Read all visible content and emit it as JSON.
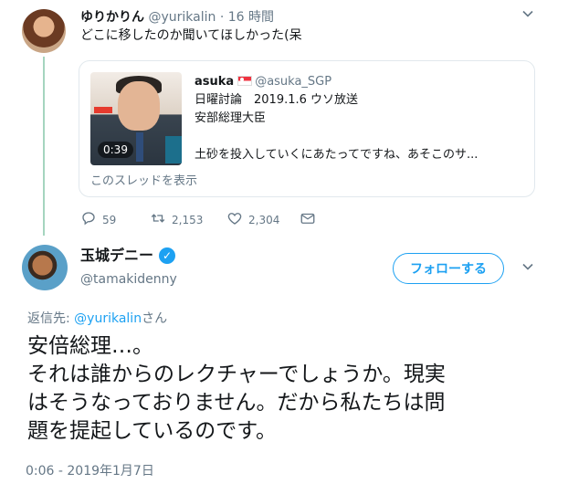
{
  "reply_tweet": {
    "name": "ゆりかりん",
    "handle": "@yurikalin",
    "separator": "·",
    "time": "16 時間",
    "text": "どこに移したのか聞いてほしかった(呆",
    "quoted": {
      "name": "asuka",
      "handle": "@asuka_SGP",
      "lines": [
        "日曜討論　2019.1.6 ウソ放送",
        "安部総理大臣",
        "土砂を投入していくにあたってですね、あそこのサ..."
      ],
      "video_duration": "0:39",
      "show_thread": "このスレッドを表示"
    },
    "actions": {
      "replies": "59",
      "retweets": "2,153",
      "likes": "2,304"
    }
  },
  "main_tweet": {
    "name": "玉城デニー",
    "handle": "@tamakidenny",
    "follow_label": "フォローする",
    "reply_prefix": "返信先: ",
    "reply_mention": "@yurikalin",
    "reply_suffix": "さん",
    "text": "安倍総理…。\nそれは誰からのレクチャーでしょうか。現実\nはそうなっておりません。だから私たちは問\n題を提起しているのです。",
    "timestamp": "0:06 - 2019年1月7日"
  },
  "colors": {
    "accent": "#1da1f2",
    "thread_line": "#a5d5bf",
    "muted": "#657786"
  },
  "icons": [
    "reply-icon",
    "retweet-icon",
    "like-icon",
    "message-icon",
    "verified-badge-icon",
    "caret-down-icon"
  ]
}
